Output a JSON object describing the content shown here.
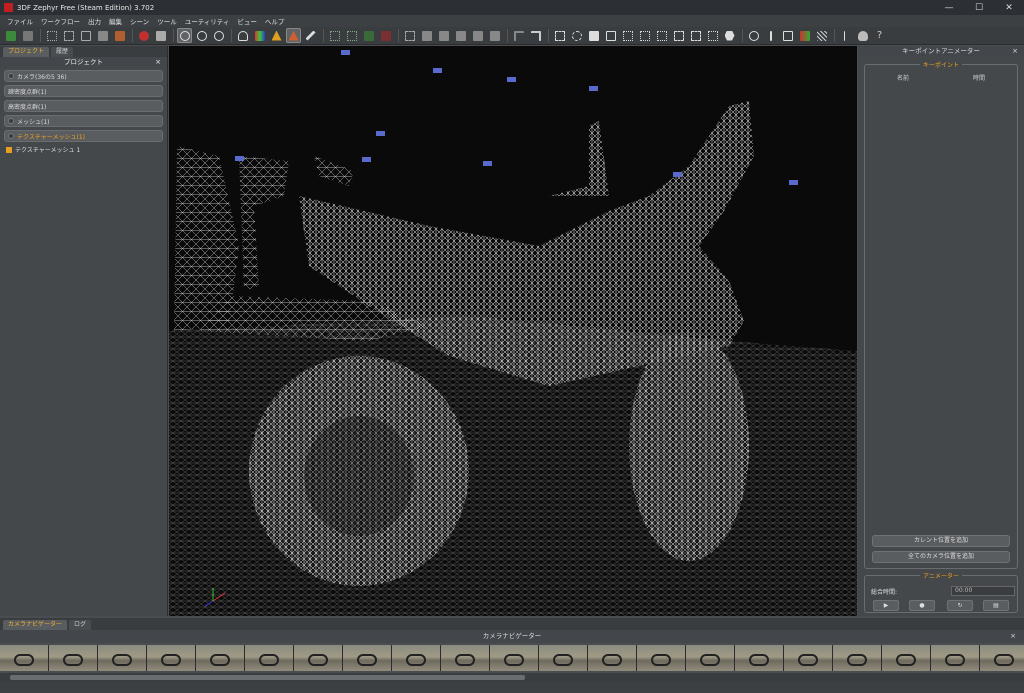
{
  "window": {
    "title": "3DF Zephyr Free (Steam Edition) 3.702",
    "minimize": "—",
    "maximize": "☐",
    "close": "✕"
  },
  "menu": [
    "ファイル",
    "ワークフロー",
    "出力",
    "編集",
    "シーン",
    "ツール",
    "ユーティリティ",
    "ビュー",
    "ヘルプ"
  ],
  "toolbar_help": "?",
  "left_panel": {
    "tabs": [
      "プロジェクト",
      "履歴"
    ],
    "header": "プロジェクト",
    "close": "×",
    "tree": [
      {
        "label": "カメラ(36の5 36)"
      },
      {
        "label": "疎密度点群(1)"
      },
      {
        "label": "高密度点群(1)"
      },
      {
        "label": "メッシュ(1)"
      },
      {
        "label": "テクスチャーメッシュ(1)"
      }
    ],
    "leaf": "テクスチャーメッシュ 1"
  },
  "right_panel": {
    "header": "キーポイントアニメーター",
    "close": "×",
    "keypoint_group": "キーポイント",
    "col_name": "名前",
    "col_time": "時間",
    "add_current": "カレント位置を追加",
    "add_all": "全てのカメラ位置を追加",
    "animator_group": "アニメーター",
    "total_time_label": "総合時間:",
    "total_time_value": "00:00",
    "play_buttons": [
      "▶",
      "●",
      "↻",
      "▤"
    ]
  },
  "bottom": {
    "tabs": [
      "カメラナビゲーター",
      "ログ"
    ],
    "header": "カメラナビゲーター",
    "close": "×",
    "thumbnail_count": 21
  }
}
